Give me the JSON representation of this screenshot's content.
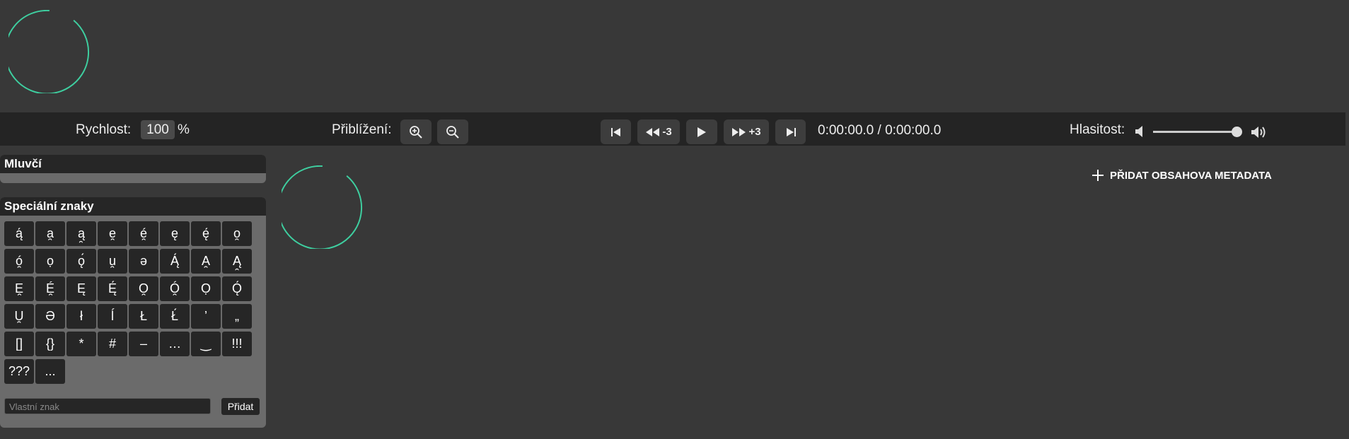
{
  "toolbar": {
    "speed_label": "Rychlost:",
    "speed_value": "100",
    "speed_unit": "%",
    "zoom_label": "Přiblížení:",
    "rewind_label": "-3",
    "forward_label": "+3",
    "time": "0:00:00.0 / 0:00:00.0",
    "volume_label": "Hlasitost:",
    "volume_level": 1.0
  },
  "speakers_panel": {
    "title": "Mluvčí"
  },
  "special_chars_panel": {
    "title": "Speciální znaky",
    "chars": [
      "ą́",
      "a̯",
      "ą̯",
      "e̯",
      "é̯",
      "ę",
      "ę́",
      "o̯",
      "ó̯",
      "ọ",
      "ǫ́",
      "u̯",
      "ə",
      "Ą́",
      "A̯",
      "Ą̯",
      "E̯",
      "É̯",
      "Ę",
      "Ę́",
      "O̯",
      "Ó̯",
      "Ọ",
      "Ǫ́",
      "U̯",
      "Ə",
      "ł",
      "ĺ",
      "Ł",
      "Ł́",
      "’",
      "„",
      "[]",
      "{}",
      "*",
      "#",
      "–",
      "…",
      "‿",
      "!!!",
      "???",
      "..."
    ],
    "custom_placeholder": "Vlastní znak",
    "add_label": "Přidat"
  },
  "metadata_button": "PŘIDAT OBSAHOVA METADATA",
  "colors": {
    "accent": "#3ecfa0",
    "background": "#383838",
    "toolbar": "#242424"
  }
}
